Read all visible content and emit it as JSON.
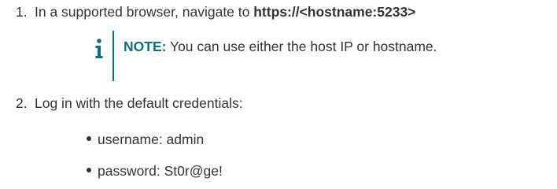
{
  "steps": [
    {
      "number": "1.",
      "text": "In a supported browser, navigate to ",
      "url": "https://<hostname:5233>"
    },
    {
      "number": "2.",
      "text": "Log in with the default credentials:"
    }
  ],
  "note": {
    "icon": "info-icon",
    "label": "NOTE:",
    "text": " You can use either the host IP or hostname."
  },
  "credentials": [
    "username: admin",
    "password: St0r@ge!"
  ],
  "colors": {
    "accent": "#0e6e76",
    "text": "#333333"
  }
}
